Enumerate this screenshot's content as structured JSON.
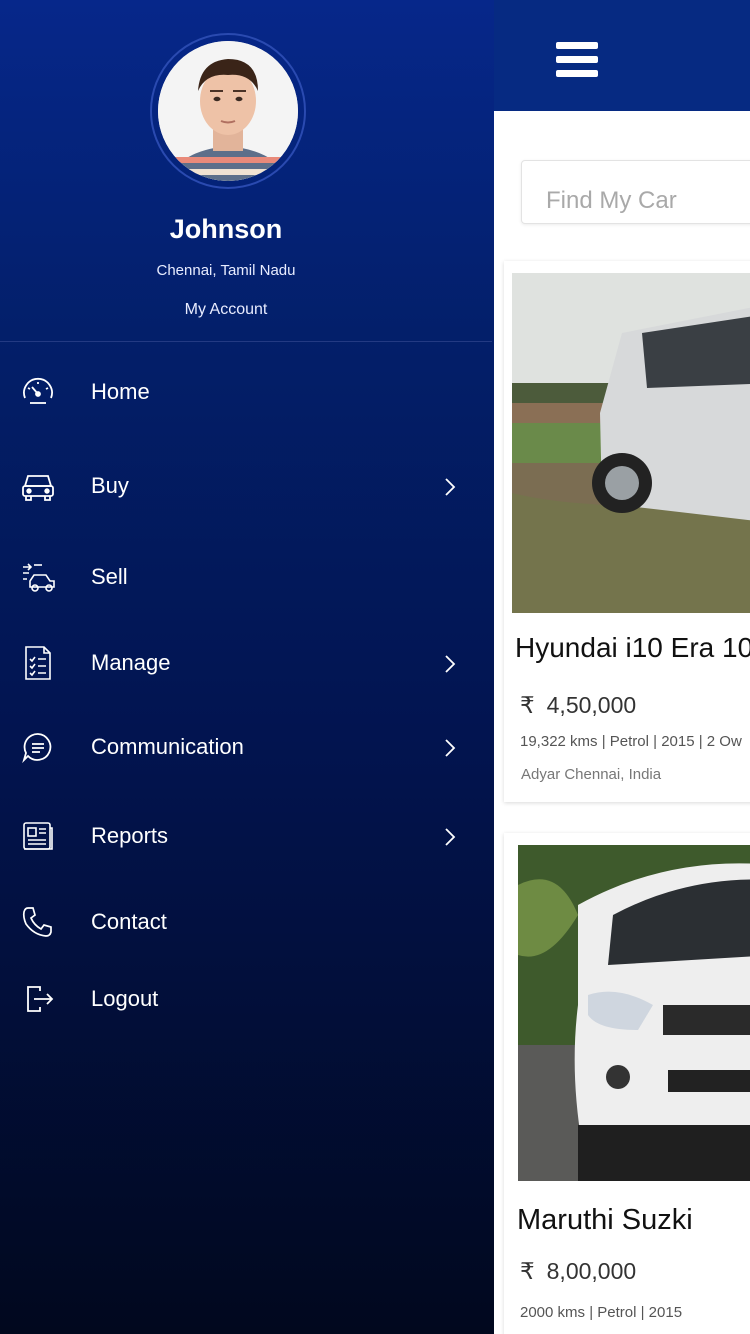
{
  "profile": {
    "name": "Johnson",
    "location": "Chennai, Tamil Nadu",
    "account_link": "My Account"
  },
  "menu": [
    {
      "label": "Home",
      "icon": "speedometer-icon",
      "has_submenu": false
    },
    {
      "label": "Buy",
      "icon": "car-icon",
      "has_submenu": true
    },
    {
      "label": "Sell",
      "icon": "sell-car-icon",
      "has_submenu": false
    },
    {
      "label": "Manage",
      "icon": "checklist-document-icon",
      "has_submenu": true
    },
    {
      "label": "Communication",
      "icon": "chat-bubble-icon",
      "has_submenu": true
    },
    {
      "label": "Reports",
      "icon": "newspaper-icon",
      "has_submenu": true
    },
    {
      "label": "Contact",
      "icon": "phone-icon",
      "has_submenu": false
    },
    {
      "label": "Logout",
      "icon": "logout-icon",
      "has_submenu": false
    }
  ],
  "header": {
    "menu_icon": "hamburger-icon"
  },
  "search": {
    "placeholder": "Find My Car"
  },
  "listings": [
    {
      "title": "Hyundai i10 Era 10",
      "currency": "₹",
      "price": "4,50,000",
      "specs": "19,322 kms | Petrol | 2015 | 2 Ow",
      "location": "Adyar Chennai, India"
    },
    {
      "title": "Maruthi Suzki",
      "currency": "₹",
      "price": "8,00,000",
      "specs": "2000 kms | Petrol | 2015"
    }
  ],
  "colors": {
    "drawer_top": "#06278a",
    "drawer_bottom": "#01081e",
    "header_bar": "#062a82",
    "text_white": "#ffffff"
  }
}
